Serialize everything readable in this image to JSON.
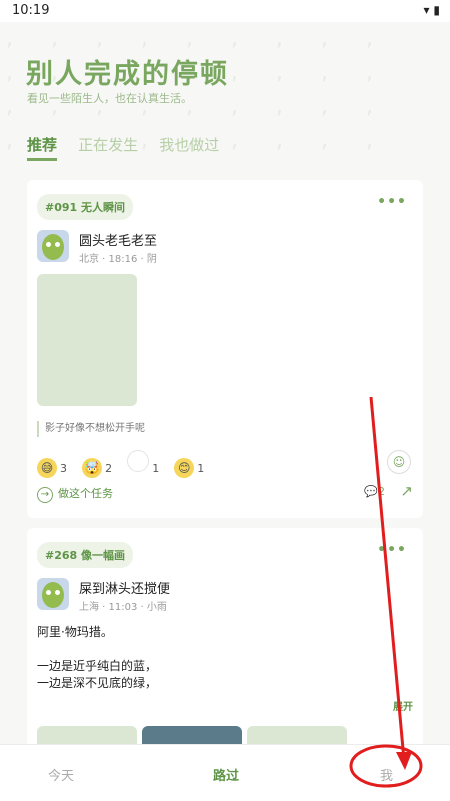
{
  "status": {
    "time": "10:19"
  },
  "header": {
    "title": "别人完成的停顿",
    "subtitle": "看见一些陌生人，也在认真生活。"
  },
  "tabs": [
    {
      "label": "推荐"
    },
    {
      "label": "正在发生"
    },
    {
      "label": "我也做过"
    }
  ],
  "cards": [
    {
      "tag": "#091 无人瞬间",
      "user": "圆头老毛老至",
      "meta": "北京 · 18:16 · 阴",
      "quote": "影子好像不想松开手呢",
      "reactions": [
        {
          "emoji": "😅",
          "count": "3"
        },
        {
          "emoji": "🤯",
          "count": "2"
        },
        {
          "emoji": "",
          "count": "1"
        },
        {
          "emoji": "😊",
          "count": "1"
        }
      ],
      "action": "做这个任务",
      "comments": "2"
    },
    {
      "tag": "#268 像一幅画",
      "user": "屎到淋头还搅便",
      "meta": "上海 · 11:03 · 小雨",
      "lines": [
        "阿里·物玛措。",
        "",
        "一边是近乎纯白的蓝，",
        "一边是深不见底的绿，"
      ],
      "expand": "展开"
    }
  ],
  "nav": {
    "today": "今天",
    "passby": "路过",
    "me": "我"
  },
  "colors": {
    "accent": "#7aa760",
    "annotation": "#e11d1d"
  }
}
